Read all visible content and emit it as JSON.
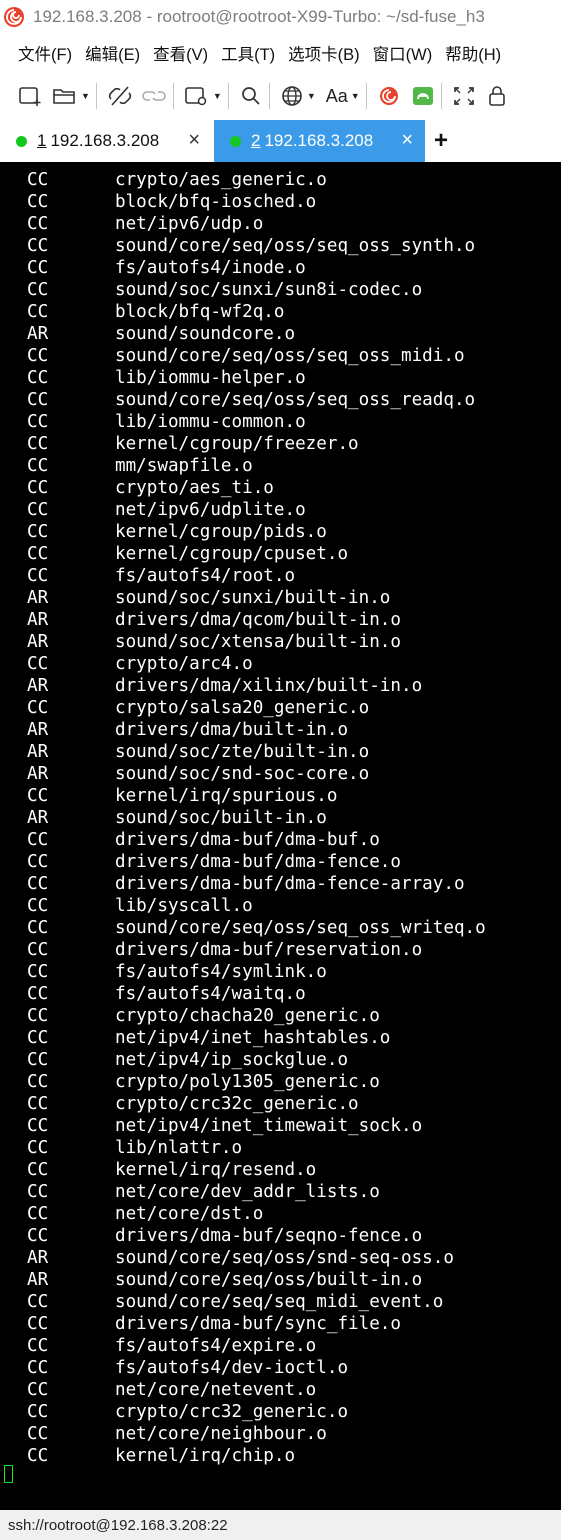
{
  "window": {
    "title": "192.168.3.208 - rootroot@rootroot-X99-Turbo: ~/sd-fuse_h3"
  },
  "menu": {
    "items": [
      "文件(F)",
      "编辑(E)",
      "查看(V)",
      "工具(T)",
      "选项卡(B)",
      "窗口(W)",
      "帮助(H)"
    ]
  },
  "toolbar": {
    "font_label": "Aa",
    "icons": [
      "new-session-icon",
      "open-folder-icon",
      "disconnect-icon",
      "reconnect-icon",
      "session-options-icon",
      "search-icon",
      "globe-icon",
      "font-icon",
      "app-logo-icon",
      "xftp-icon",
      "fullscreen-icon",
      "lock-icon"
    ]
  },
  "tabs": [
    {
      "num": "1",
      "label": " 192.168.3.208",
      "active": false,
      "status": "connected"
    },
    {
      "num": "2",
      "label": " 192.168.3.208",
      "active": true,
      "status": "connected"
    }
  ],
  "tab_add_label": "+",
  "terminal": {
    "lines": [
      {
        "tag": "CC",
        "path": "crypto/aes_generic.o"
      },
      {
        "tag": "CC",
        "path": "block/bfq-iosched.o"
      },
      {
        "tag": "CC",
        "path": "net/ipv6/udp.o"
      },
      {
        "tag": "CC",
        "path": "sound/core/seq/oss/seq_oss_synth.o"
      },
      {
        "tag": "CC",
        "path": "fs/autofs4/inode.o"
      },
      {
        "tag": "CC",
        "path": "sound/soc/sunxi/sun8i-codec.o"
      },
      {
        "tag": "CC",
        "path": "block/bfq-wf2q.o"
      },
      {
        "tag": "AR",
        "path": "sound/soundcore.o"
      },
      {
        "tag": "CC",
        "path": "sound/core/seq/oss/seq_oss_midi.o"
      },
      {
        "tag": "CC",
        "path": "lib/iommu-helper.o"
      },
      {
        "tag": "CC",
        "path": "sound/core/seq/oss/seq_oss_readq.o"
      },
      {
        "tag": "CC",
        "path": "lib/iommu-common.o"
      },
      {
        "tag": "CC",
        "path": "kernel/cgroup/freezer.o"
      },
      {
        "tag": "CC",
        "path": "mm/swapfile.o"
      },
      {
        "tag": "CC",
        "path": "crypto/aes_ti.o"
      },
      {
        "tag": "CC",
        "path": "net/ipv6/udplite.o"
      },
      {
        "tag": "CC",
        "path": "kernel/cgroup/pids.o"
      },
      {
        "tag": "CC",
        "path": "kernel/cgroup/cpuset.o"
      },
      {
        "tag": "CC",
        "path": "fs/autofs4/root.o"
      },
      {
        "tag": "AR",
        "path": "sound/soc/sunxi/built-in.o"
      },
      {
        "tag": "AR",
        "path": "drivers/dma/qcom/built-in.o"
      },
      {
        "tag": "AR",
        "path": "sound/soc/xtensa/built-in.o"
      },
      {
        "tag": "CC",
        "path": "crypto/arc4.o"
      },
      {
        "tag": "AR",
        "path": "drivers/dma/xilinx/built-in.o"
      },
      {
        "tag": "CC",
        "path": "crypto/salsa20_generic.o"
      },
      {
        "tag": "AR",
        "path": "drivers/dma/built-in.o"
      },
      {
        "tag": "AR",
        "path": "sound/soc/zte/built-in.o"
      },
      {
        "tag": "AR",
        "path": "sound/soc/snd-soc-core.o"
      },
      {
        "tag": "CC",
        "path": "kernel/irq/spurious.o"
      },
      {
        "tag": "AR",
        "path": "sound/soc/built-in.o"
      },
      {
        "tag": "CC",
        "path": "drivers/dma-buf/dma-buf.o"
      },
      {
        "tag": "CC",
        "path": "drivers/dma-buf/dma-fence.o"
      },
      {
        "tag": "CC",
        "path": "drivers/dma-buf/dma-fence-array.o"
      },
      {
        "tag": "CC",
        "path": "lib/syscall.o"
      },
      {
        "tag": "CC",
        "path": "sound/core/seq/oss/seq_oss_writeq.o"
      },
      {
        "tag": "CC",
        "path": "drivers/dma-buf/reservation.o"
      },
      {
        "tag": "CC",
        "path": "fs/autofs4/symlink.o"
      },
      {
        "tag": "CC",
        "path": "fs/autofs4/waitq.o"
      },
      {
        "tag": "CC",
        "path": "crypto/chacha20_generic.o"
      },
      {
        "tag": "CC",
        "path": "net/ipv4/inet_hashtables.o"
      },
      {
        "tag": "CC",
        "path": "net/ipv4/ip_sockglue.o"
      },
      {
        "tag": "CC",
        "path": "crypto/poly1305_generic.o"
      },
      {
        "tag": "CC",
        "path": "crypto/crc32c_generic.o"
      },
      {
        "tag": "CC",
        "path": "net/ipv4/inet_timewait_sock.o"
      },
      {
        "tag": "CC",
        "path": "lib/nlattr.o"
      },
      {
        "tag": "CC",
        "path": "kernel/irq/resend.o"
      },
      {
        "tag": "CC",
        "path": "net/core/dev_addr_lists.o"
      },
      {
        "tag": "CC",
        "path": "net/core/dst.o"
      },
      {
        "tag": "CC",
        "path": "drivers/dma-buf/seqno-fence.o"
      },
      {
        "tag": "AR",
        "path": "sound/core/seq/oss/snd-seq-oss.o"
      },
      {
        "tag": "AR",
        "path": "sound/core/seq/oss/built-in.o"
      },
      {
        "tag": "CC",
        "path": "sound/core/seq/seq_midi_event.o"
      },
      {
        "tag": "CC",
        "path": "drivers/dma-buf/sync_file.o"
      },
      {
        "tag": "CC",
        "path": "fs/autofs4/expire.o"
      },
      {
        "tag": "CC",
        "path": "fs/autofs4/dev-ioctl.o"
      },
      {
        "tag": "CC",
        "path": "net/core/netevent.o"
      },
      {
        "tag": "CC",
        "path": "crypto/crc32_generic.o"
      },
      {
        "tag": "CC",
        "path": "net/core/neighbour.o"
      },
      {
        "tag": "CC",
        "path": "kernel/irq/chip.o"
      }
    ]
  },
  "status": {
    "text": "ssh://rootroot@192.168.3.208:22"
  },
  "colors": {
    "terminal_bg": "#000000",
    "terminal_fg": "#ffffff",
    "active_tab": "#3c9be8",
    "connected_dot": "#13c91e",
    "cursor": "#1ee01e"
  }
}
